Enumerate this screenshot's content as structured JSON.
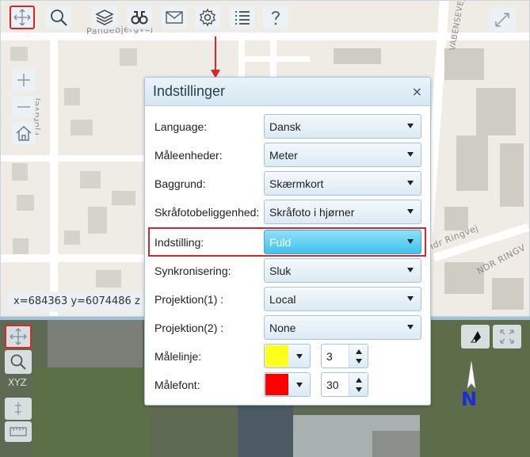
{
  "map": {
    "road_labels": [
      "Pandebjergvej",
      "Fjordvej",
      "VABENSEVEJ",
      "Idr Ringvej",
      "NDR RINGV"
    ],
    "coords": "x=684363 y=6074486 z"
  },
  "aerial_panel": {
    "xyz_label": "XYZ",
    "north_label": "N"
  },
  "toolbar": {
    "icons": [
      "pan-icon",
      "search-icon",
      "layers-icon",
      "binoculars-icon",
      "mail-icon",
      "gear-icon",
      "list-icon",
      "help-icon"
    ],
    "active": "pan-icon"
  },
  "dialog": {
    "title": "Indstillinger",
    "close": "×",
    "rows": [
      {
        "label": "Language:",
        "value": "Dansk"
      },
      {
        "label": "Måleenheder:",
        "value": "Meter"
      },
      {
        "label": "Baggrund:",
        "value": "Skærmkort"
      },
      {
        "label": "Skråfotobeliggenhed:",
        "value": "Skråfoto i hjørner"
      },
      {
        "label": "Indstilling:",
        "value": "Fuld"
      },
      {
        "label": "Synkronisering:",
        "value": "Sluk"
      },
      {
        "label": "Projektion(1) :",
        "value": "Local"
      },
      {
        "label": "Projektion(2) :",
        "value": "None"
      }
    ],
    "maalelinje": {
      "label": "Målelinje:",
      "color": "#ffff1a",
      "value": "3"
    },
    "maalefont": {
      "label": "Målefont:",
      "color": "#ff0000",
      "value": "30"
    }
  },
  "colors": {
    "accent_red": "#d9262b",
    "highlight_blue": "#3ec3ee"
  }
}
